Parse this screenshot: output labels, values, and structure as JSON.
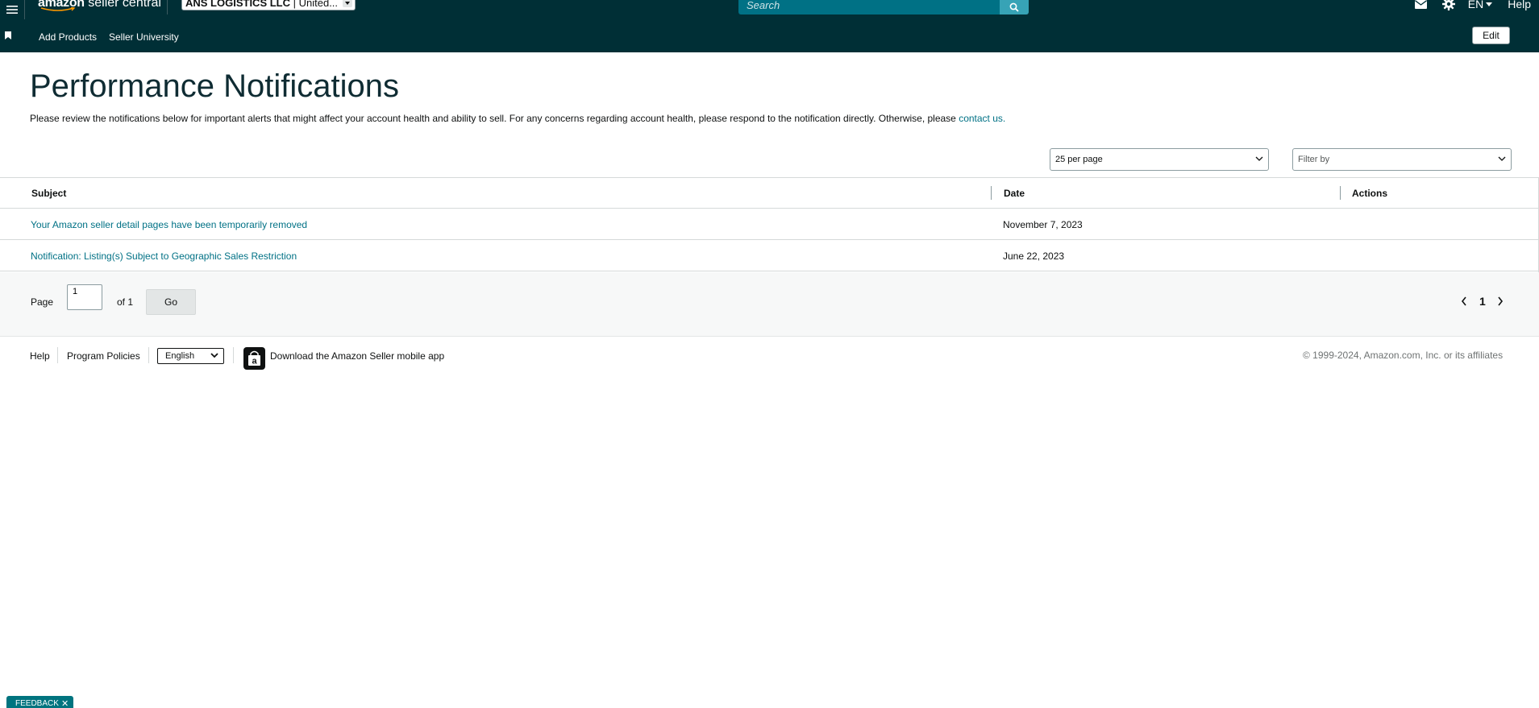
{
  "header": {
    "logo_brand": "amazon",
    "logo_product": "seller central",
    "account": {
      "name": "ANS LOGISTICS LLC",
      "market": "| United..."
    },
    "search_placeholder": "Search",
    "language": "EN",
    "help": "Help"
  },
  "subnav": {
    "links": [
      "Add Products",
      "Seller University"
    ],
    "edit_label": "Edit"
  },
  "page": {
    "title": "Performance Notifications",
    "description": "Please review the notifications below for important alerts that might affect your account health and ability to sell. For any concerns regarding account health, please respond to the notification directly. Otherwise, please ",
    "contact_link": "contact us."
  },
  "controls": {
    "per_page": "25 per page",
    "filter_placeholder": "Filter by"
  },
  "table": {
    "columns": [
      "Subject",
      "Date",
      "Actions"
    ],
    "rows": [
      {
        "subject": "Your Amazon seller detail pages have been temporarily removed",
        "date": "November 7, 2023"
      },
      {
        "subject": "Notification: Listing(s) Subject to Geographic Sales Restriction",
        "date": "June 22, 2023"
      }
    ]
  },
  "pagination": {
    "page_label": "Page",
    "current_page": "1",
    "of_label": "of 1",
    "go_label": "Go",
    "page_number": "1"
  },
  "footer": {
    "help": "Help",
    "policies": "Program Policies",
    "language": "English",
    "app_text": "Download the Amazon Seller mobile app",
    "copyright": "© 1999-2024, Amazon.com, Inc. or its affiliates"
  },
  "feedback": {
    "label": "FEEDBACK"
  },
  "colors": {
    "nav_bg": "#002f36",
    "link": "#007185",
    "search_bg": "#007185",
    "feedback_bg": "#00747f"
  },
  "icons": [
    "menu-icon",
    "smile-arrow-icon",
    "caret-down-icon",
    "search-icon",
    "mail-icon",
    "gear-icon",
    "bookmark-icon",
    "chevron-down-icon",
    "chevron-left-icon",
    "chevron-right-icon",
    "amazon-app-icon",
    "close-icon"
  ]
}
